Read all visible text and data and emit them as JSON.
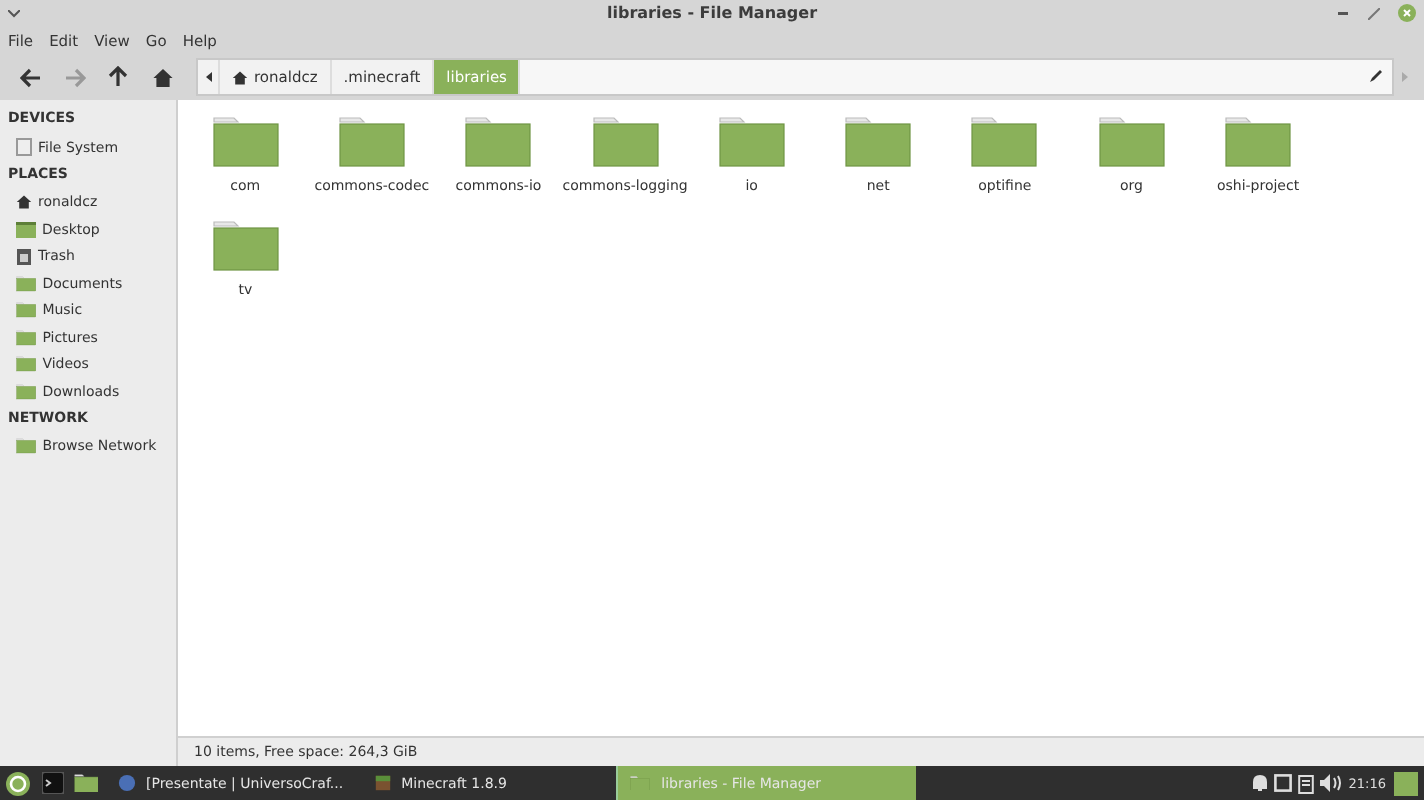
{
  "window": {
    "title": "libraries - File Manager"
  },
  "menu": [
    "File",
    "Edit",
    "View",
    "Go",
    "Help"
  ],
  "path": [
    {
      "label": "ronaldcz",
      "kind": "home",
      "selected": false
    },
    {
      "label": ".minecraft",
      "kind": "plain",
      "selected": false
    },
    {
      "label": "libraries",
      "kind": "plain",
      "selected": true
    }
  ],
  "sidebar": [
    {
      "heading": "DEVICES",
      "items": [
        {
          "label": "File System",
          "kind": "drive"
        }
      ]
    },
    {
      "heading": "PLACES",
      "items": [
        {
          "label": "ronaldcz",
          "kind": "home"
        },
        {
          "label": "Desktop",
          "kind": "desktop"
        },
        {
          "label": "Trash",
          "kind": "trash"
        },
        {
          "label": "Documents",
          "kind": "folder"
        },
        {
          "label": "Music",
          "kind": "folder"
        },
        {
          "label": "Pictures",
          "kind": "folder"
        },
        {
          "label": "Videos",
          "kind": "folder"
        },
        {
          "label": "Downloads",
          "kind": "folder"
        }
      ]
    },
    {
      "heading": "NETWORK",
      "items": [
        {
          "label": "Browse Network",
          "kind": "folder"
        }
      ]
    }
  ],
  "files": [
    "com",
    "commons-codec",
    "commons-io",
    "commons-logging",
    "io",
    "net",
    "optifine",
    "org",
    "oshi-project",
    "tv"
  ],
  "status_bar": "10 items, Free space: 264,3 GiB",
  "taskbar": {
    "windows": [
      {
        "label": "[Presentate | UniversoCraf...",
        "kind": "browser",
        "selected": false
      },
      {
        "label": "Minecraft 1.8.9",
        "kind": "game",
        "selected": false
      },
      {
        "label": "libraries - File Manager",
        "kind": "folder",
        "selected": true
      }
    ],
    "clock": "21:16"
  }
}
